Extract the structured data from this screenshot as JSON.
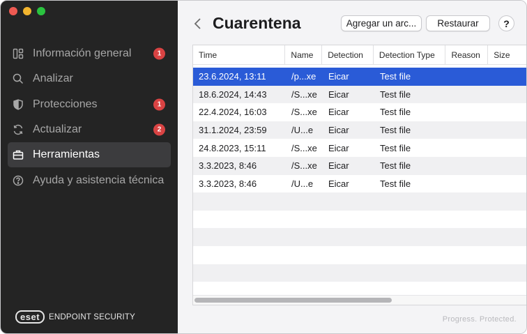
{
  "sidebar": {
    "items": [
      {
        "label": "Información general",
        "icon": "dashboard-icon",
        "badge": "1"
      },
      {
        "label": "Analizar",
        "icon": "search-icon",
        "badge": ""
      },
      {
        "label": "Protecciones",
        "icon": "shield-icon",
        "badge": "1"
      },
      {
        "label": "Actualizar",
        "icon": "refresh-icon",
        "badge": "2"
      },
      {
        "label": "Herramientas",
        "icon": "briefcase-icon",
        "badge": "",
        "active": true
      },
      {
        "label": "Ayuda y asistencia técnica",
        "icon": "help-circle-icon",
        "badge": ""
      }
    ],
    "brand_logo": "eset",
    "brand_text": "ENDPOINT SECURITY"
  },
  "header": {
    "title": "Cuarentena",
    "add_button": "Agregar un arc...",
    "restore_button": "Restaurar",
    "help_button": "?"
  },
  "table": {
    "columns": [
      "Time",
      "Name",
      "Detection",
      "Detection Type",
      "Reason",
      "Size"
    ],
    "rows": [
      {
        "time": "23.6.2024, 13:11",
        "name": "/p...xe",
        "detection": "Eicar",
        "type": "Test file",
        "selected": true
      },
      {
        "time": "18.6.2024, 14:43",
        "name": "/S...xe",
        "detection": "Eicar",
        "type": "Test file"
      },
      {
        "time": "22.4.2024, 16:03",
        "name": "/S...xe",
        "detection": "Eicar",
        "type": "Test file"
      },
      {
        "time": "31.1.2024, 23:59",
        "name": "/U...e",
        "detection": "Eicar",
        "type": "Test file"
      },
      {
        "time": "24.8.2023, 15:11",
        "name": "/S...xe",
        "detection": "Eicar",
        "type": "Test file"
      },
      {
        "time": "3.3.2023, 8:46",
        "name": "/S...xe",
        "detection": "Eicar",
        "type": "Test file"
      },
      {
        "time": "3.3.2023, 8:46",
        "name": "/U...e",
        "detection": "Eicar",
        "type": "Test file"
      }
    ]
  },
  "footer": {
    "tagline": "Progress. Protected."
  },
  "colors": {
    "selection": "#2a5bd7",
    "badge": "#d94343",
    "sidebar_bg": "#242424"
  }
}
